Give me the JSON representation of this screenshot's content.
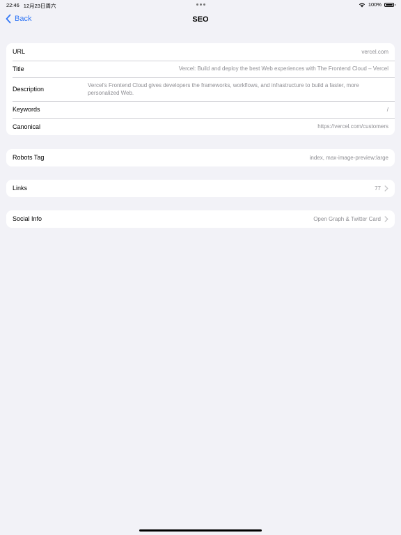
{
  "status_bar": {
    "time": "22:46",
    "date": "12月23日周六",
    "battery_text": "100%"
  },
  "nav": {
    "back_label": "Back",
    "title": "SEO"
  },
  "meta_group": {
    "rows": [
      {
        "label": "URL",
        "value": "vercel.com"
      },
      {
        "label": "Title",
        "value": "Vercel: Build and deploy the best Web experiences with The Frontend Cloud – Vercel"
      },
      {
        "label": "Description",
        "value": "Vercel's Frontend Cloud gives developers the frameworks, workflows, and infrastructure to build a faster, more personalized Web."
      },
      {
        "label": "Keywords",
        "value": "/"
      },
      {
        "label": "Canonical",
        "value": "https://vercel.com/customers"
      }
    ]
  },
  "robots": {
    "label": "Robots Tag",
    "value": "index, max-image-preview:large"
  },
  "links": {
    "label": "Links",
    "value": "77"
  },
  "social": {
    "label": "Social Info",
    "value": "Open Graph & Twitter Card"
  },
  "colors": {
    "accent": "#3478f6",
    "background": "#f2f2f7",
    "secondary_text": "#8e8e93"
  }
}
